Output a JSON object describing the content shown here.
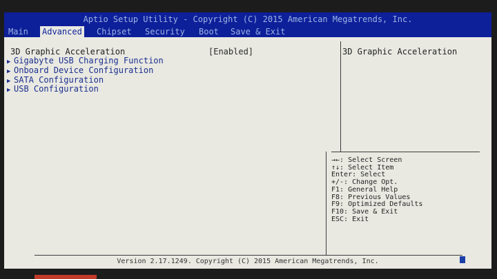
{
  "title": "Aptio Setup Utility - Copyright (C) 2015 American Megatrends, Inc.",
  "tabs": [
    "Main",
    "Advanced",
    "Chipset",
    "Security",
    "Boot",
    "Save & Exit"
  ],
  "active_tab": "Advanced",
  "menu": {
    "items": [
      {
        "label": "3D Graphic Acceleration",
        "value": "[Enabled]"
      },
      {
        "label": "Gigabyte USB Charging Function"
      },
      {
        "label": "Onboard Device Configuration"
      },
      {
        "label": "SATA Configuration"
      },
      {
        "label": "USB Configuration"
      }
    ]
  },
  "help": {
    "title": "3D Graphic Acceleration",
    "keys": [
      "→←: Select Screen",
      "↑↓: Select Item",
      "Enter: Select",
      "+/-: Change Opt.",
      "F1: General Help",
      "F8: Previous Values",
      "F9: Optimized Defaults",
      "F10: Save & Exit",
      "ESC: Exit"
    ]
  },
  "footer": "Version 2.17.1249. Copyright (C) 2015 American Megatrends, Inc.",
  "colors": {
    "bar": "#0e1f9a",
    "bar_text": "#9bb5e3",
    "screen_bg": "#e9e9e2",
    "menu_text": "#1c2f8e"
  },
  "icons": {
    "submenu": "triangle-right-icon"
  }
}
